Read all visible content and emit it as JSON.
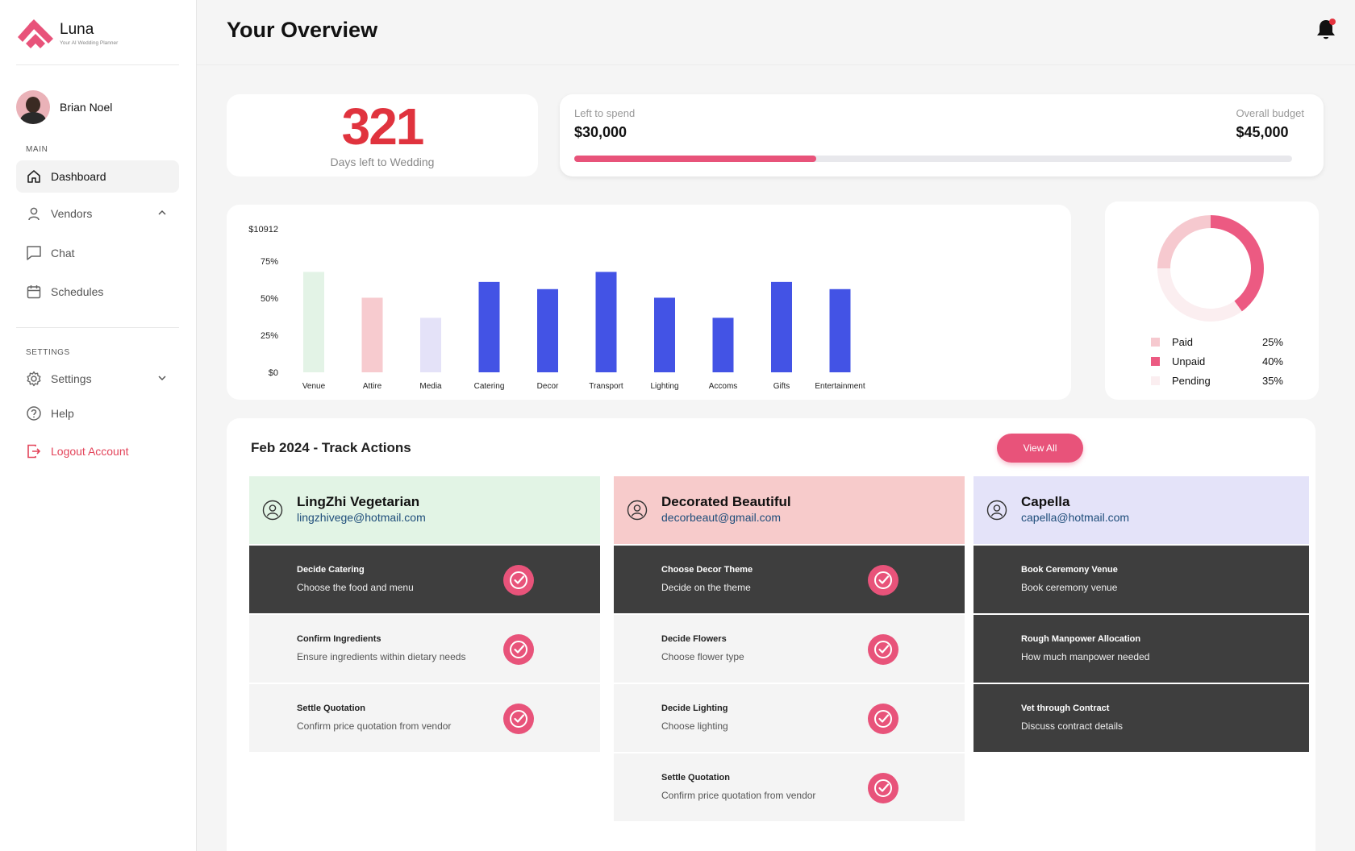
{
  "app": {
    "name": "Luna",
    "tagline": "Your AI Wedding Planner"
  },
  "user": {
    "name": "Brian Noel"
  },
  "sidebar": {
    "main_label": "MAIN",
    "settings_label": "SETTINGS",
    "items": [
      {
        "label": "Dashboard",
        "icon": "home-icon"
      },
      {
        "label": "Vendors",
        "icon": "user-icon"
      },
      {
        "label": "Chat",
        "icon": "chat-icon"
      },
      {
        "label": "Schedules",
        "icon": "calendar-icon"
      }
    ],
    "settings_items": [
      {
        "label": "Settings",
        "icon": "gear-icon"
      },
      {
        "label": "Help",
        "icon": "help-icon"
      },
      {
        "label": "Logout Account",
        "icon": "logout-icon"
      }
    ]
  },
  "header": {
    "title": "Your Overview"
  },
  "countdown": {
    "days": "321",
    "label": "Days left to Wedding"
  },
  "budget": {
    "left_label": "Left to spend",
    "left_value": "$30,000",
    "overall_label": "Overall budget",
    "overall_value": "$45,000",
    "progress": 0.337
  },
  "chart_data": [
    {
      "type": "bar",
      "categories": [
        "Venue",
        "Attire",
        "Media",
        "Catering",
        "Decor",
        "Transport",
        "Lighting",
        "Accoms",
        "Gifts",
        "Entertainment"
      ],
      "values": [
        70,
        52,
        38,
        63,
        58,
        70,
        52,
        38,
        63,
        58
      ],
      "colors": [
        "#e3f3e6",
        "#f7cbcf",
        "#e4e2f8",
        "#4353e5",
        "#4353e5",
        "#4353e5",
        "#4353e5",
        "#4353e5",
        "#4353e5",
        "#4353e5"
      ],
      "ytick_labels": [
        "$0",
        "25%",
        "50%",
        "75%",
        "$10912"
      ],
      "ylim": [
        0,
        100
      ],
      "grid": false
    },
    {
      "type": "pie",
      "categories": [
        "Paid",
        "Unpaid",
        "Pending"
      ],
      "values": [
        25,
        40,
        35
      ],
      "labels": [
        "25%",
        "40%",
        "35%"
      ],
      "colors": [
        "#f6c9cf",
        "#ec5a82",
        "#fbeef0"
      ]
    }
  ],
  "track": {
    "title": "Feb 2024 - Track Actions",
    "view_all": "View All",
    "vendors": [
      {
        "name": "LingZhi Vegetarian",
        "email": "lingzhivege@hotmail.com",
        "color": "#e2f4e5",
        "tasks": [
          {
            "title": "Decide Catering",
            "desc": "Choose the food and menu",
            "style": "dark",
            "check": true
          },
          {
            "title": "Confirm Ingredients",
            "desc": "Ensure ingredients within dietary needs",
            "style": "light",
            "check": true
          },
          {
            "title": "Settle Quotation",
            "desc": "Confirm price quotation from vendor",
            "style": "light",
            "check": true
          }
        ]
      },
      {
        "name": "Decorated Beautiful",
        "email": "decorbeaut@gmail.com",
        "color": "#f7cbcb",
        "tasks": [
          {
            "title": "Choose Decor Theme",
            "desc": "Decide on the theme",
            "style": "dark",
            "check": true
          },
          {
            "title": "Decide Flowers",
            "desc": "Choose flower type",
            "style": "light",
            "check": true
          },
          {
            "title": "Decide Lighting",
            "desc": "Choose lighting",
            "style": "light",
            "check": true
          },
          {
            "title": "Settle Quotation",
            "desc": "Confirm price quotation from vendor",
            "style": "light",
            "check": true
          }
        ]
      },
      {
        "name": "Capella",
        "email": "capella@hotmail.com",
        "color": "#e4e3f9",
        "tasks": [
          {
            "title": "Book Ceremony Venue",
            "desc": "Book ceremony venue",
            "style": "dark",
            "check": false
          },
          {
            "title": "Rough Manpower Allocation",
            "desc": "How much manpower needed",
            "style": "dark",
            "check": false
          },
          {
            "title": "Vet through Contract",
            "desc": "Discuss contract details",
            "style": "dark",
            "check": false
          }
        ]
      }
    ]
  }
}
